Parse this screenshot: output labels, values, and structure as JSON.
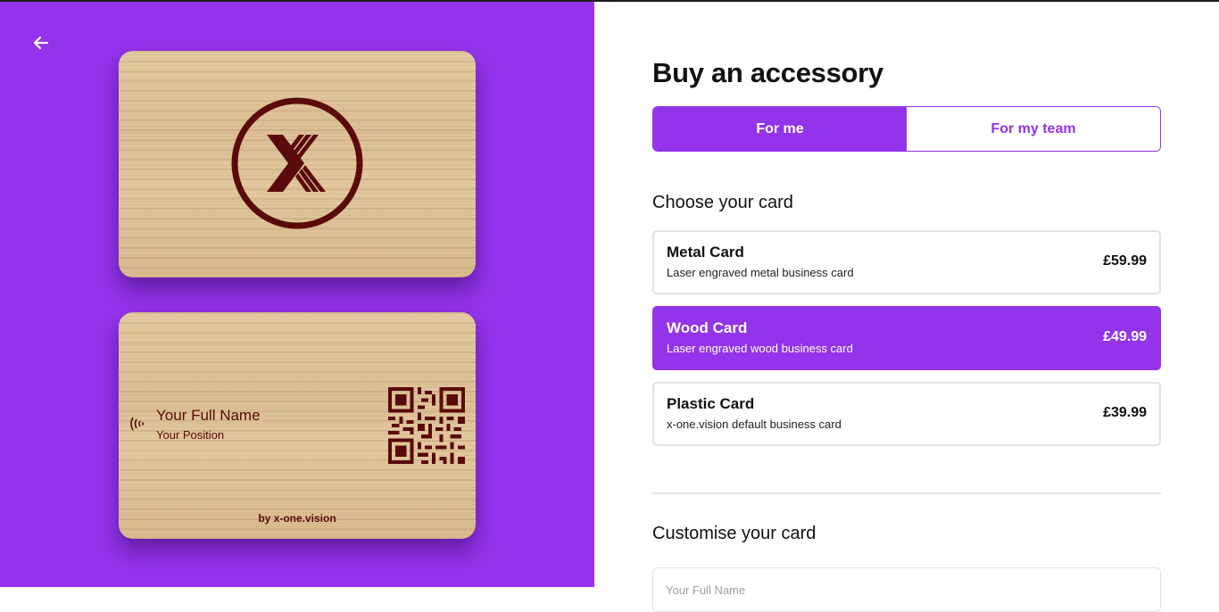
{
  "colors": {
    "accent": "#9333ea",
    "engrave": "#5a0a0a"
  },
  "preview": {
    "back_icon": "arrow-left-icon",
    "card_name": "Your Full Name",
    "card_position": "Your Position",
    "card_byline": "by x-one.vision"
  },
  "main": {
    "title": "Buy an accessory",
    "tabs": [
      {
        "label": "For me",
        "active": true
      },
      {
        "label": "For my team",
        "active": false
      }
    ],
    "choose_heading": "Choose your card",
    "cards": [
      {
        "name": "Metal Card",
        "description": "Laser engraved metal business card",
        "price": "£59.99",
        "selected": false
      },
      {
        "name": "Wood Card",
        "description": "Laser engraved wood business card",
        "price": "£49.99",
        "selected": true
      },
      {
        "name": "Plastic Card",
        "description": "x-one.vision default business card",
        "price": "£39.99",
        "selected": false
      }
    ],
    "customise_heading": "Customise your card",
    "name_field": {
      "placeholder": "Your Full Name",
      "value": ""
    }
  }
}
